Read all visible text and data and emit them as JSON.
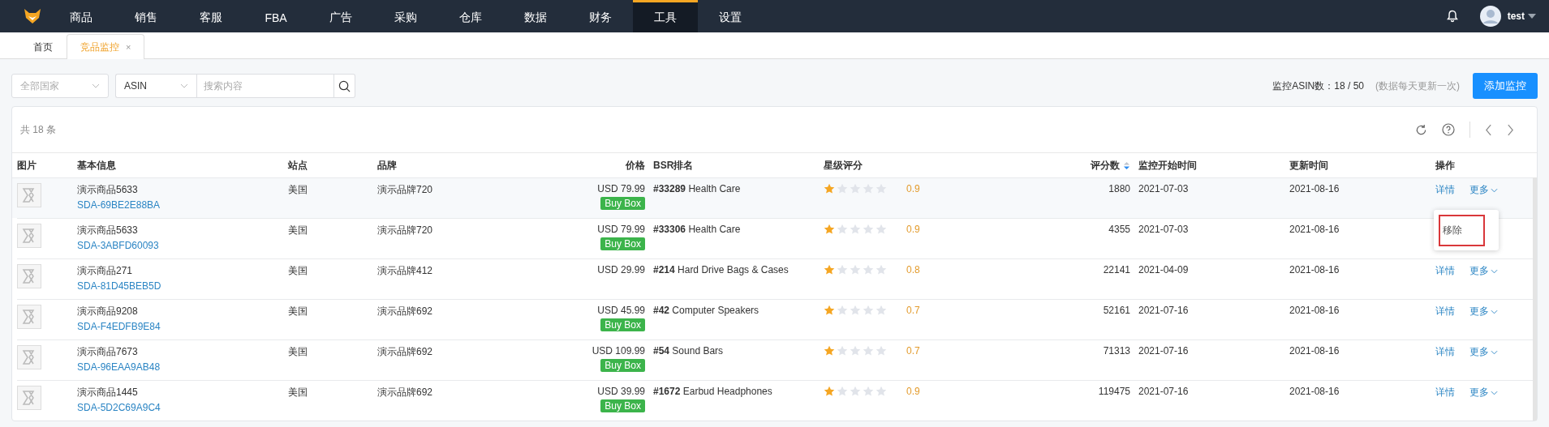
{
  "nav": {
    "items": [
      {
        "label": "商品",
        "selected": false
      },
      {
        "label": "销售",
        "selected": false
      },
      {
        "label": "客服",
        "selected": false
      },
      {
        "label": "FBA",
        "selected": false
      },
      {
        "label": "广告",
        "selected": false
      },
      {
        "label": "采购",
        "selected": false
      },
      {
        "label": "仓库",
        "selected": false
      },
      {
        "label": "数据",
        "selected": false
      },
      {
        "label": "财务",
        "selected": false
      },
      {
        "label": "工具",
        "selected": true
      },
      {
        "label": "设置",
        "selected": false
      }
    ],
    "user": "test"
  },
  "tabs": [
    {
      "label": "首页",
      "selected": false,
      "closable": false
    },
    {
      "label": "竞品监控",
      "selected": true,
      "closable": true,
      "close": "×"
    }
  ],
  "filters": {
    "country": {
      "placeholder": "全部国家"
    },
    "type": {
      "value": "ASIN"
    },
    "search": {
      "placeholder": "搜索内容"
    },
    "quota_label": "监控ASIN数：18 / 50",
    "quota_note": "(数据每天更新一次)",
    "add_button": "添加监控"
  },
  "table": {
    "total": "共 18 条",
    "columns": [
      {
        "label": "图片"
      },
      {
        "label": "基本信息"
      },
      {
        "label": "站点"
      },
      {
        "label": "品牌"
      },
      {
        "label": "价格"
      },
      {
        "label": "BSR排名"
      },
      {
        "label": "星级评分"
      },
      {
        "label": "评分数",
        "sortable": true
      },
      {
        "label": "监控开始时间"
      },
      {
        "label": "更新时间"
      },
      {
        "label": "操作"
      }
    ],
    "rows": [
      {
        "name": "演示商品5633",
        "sku": "SDA-69BE2E88BA",
        "site": "美国",
        "brand": "演示品牌720",
        "price": "USD 79.99",
        "buy_box": "Buy Box",
        "bsr": "**#33289** Health Care",
        "stars": 1,
        "rating": "0.9",
        "reviews": "1880",
        "start": "2021-07-03",
        "updated": "2021-08-16",
        "actions": [
          "详情",
          "更多"
        ]
      },
      {
        "name": "演示商品5633",
        "sku": "SDA-3ABFD60093",
        "site": "美国",
        "brand": "演示品牌720",
        "price": "USD 79.99",
        "buy_box": "Buy Box",
        "bsr": "**#33306** Health Care",
        "stars": 1,
        "rating": "0.9",
        "reviews": "4355",
        "start": "2021-07-03",
        "updated": "2021-08-16"
      },
      {
        "name": "演示商品271",
        "sku": "SDA-81D45BEB5D",
        "site": "美国",
        "brand": "演示品牌412",
        "price": "USD 29.99",
        "bsr": "**#214** Hard Drive Bags & Cases",
        "stars": 1,
        "rating": "0.8",
        "reviews": "22141",
        "start": "2021-04-09",
        "updated": "2021-08-16",
        "actions": [
          "详情",
          "更多"
        ]
      },
      {
        "name": "演示商品9208",
        "sku": "SDA-F4EDFB9E84",
        "site": "美国",
        "brand": "演示品牌692",
        "price": "USD 45.99",
        "buy_box": "Buy Box",
        "bsr": "**#42** Computer Speakers",
        "stars": 1,
        "rating": "0.7",
        "reviews": "52161",
        "start": "2021-07-16",
        "updated": "2021-08-16",
        "actions": [
          "详情",
          "更多"
        ]
      },
      {
        "name": "演示商品7673",
        "sku": "SDA-96EAA9AB48",
        "site": "美国",
        "brand": "演示品牌692",
        "price": "USD 109.99",
        "buy_box": "Buy Box",
        "bsr": "**#54** Sound Bars",
        "stars": 1,
        "rating": "0.7",
        "reviews": "71313",
        "start": "2021-07-16",
        "updated": "2021-08-16",
        "actions": [
          "详情",
          "更多"
        ]
      },
      {
        "name": "演示商品1445",
        "sku": "SDA-5D2C69A9C4",
        "site": "美国",
        "brand": "演示品牌692",
        "price": "USD 39.99",
        "buy_box": "Buy Box",
        "bsr": "**#1672** Earbud Headphones",
        "stars": 1,
        "rating": "0.9",
        "reviews": "119475",
        "start": "2021-07-16",
        "updated": "2021-08-16",
        "actions": [
          "详情",
          "更多"
        ]
      }
    ]
  },
  "dropdown_menu": {
    "items": [
      "移除"
    ]
  }
}
